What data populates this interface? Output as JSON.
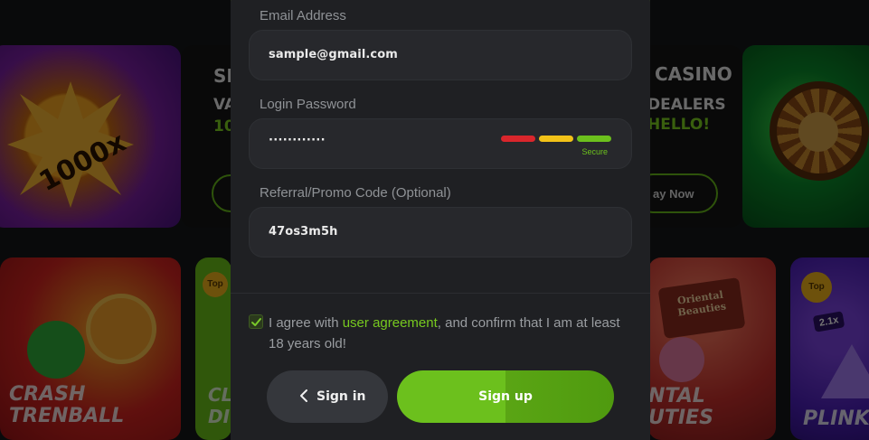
{
  "background": {
    "burst_card": {
      "label": "1000x"
    },
    "promo_left": {
      "line1": "SL",
      "line2": "VA",
      "line3": "10"
    },
    "promo_right": {
      "title": "CASINO",
      "line2": "DEALERS",
      "line3": "HELLO!",
      "button": "ay Now"
    },
    "crash_card": {
      "line1": "CRASH",
      "line2": "TRENBALL"
    },
    "green_card": {
      "badge": "Top",
      "line1": "CL",
      "line2": "DI"
    },
    "oriental_card": {
      "badge_line1": "Oriental",
      "badge_line2": "Beauties",
      "line1": "NTAL",
      "line2": "UTIES"
    },
    "plinko_card": {
      "badge": "Top",
      "multiplier": "2.1x",
      "title": "PLINKO"
    }
  },
  "form": {
    "email": {
      "label": "Email Address",
      "value": "sample@gmail.com"
    },
    "password": {
      "label": "Login Password",
      "value": "············",
      "strength_label": "Secure",
      "strength_colors": [
        "#d9262c",
        "#f2c218",
        "#6cc01d"
      ]
    },
    "referral": {
      "label": "Referral/Promo Code (Optional)",
      "value": "47os3m5h"
    },
    "agreement": {
      "prefix": "I agree with ",
      "link": "user agreement",
      "suffix": ", and confirm that I am at least 18 years old!",
      "checked": true
    },
    "signin_label": "Sign in",
    "signup_label": "Sign up"
  },
  "colors": {
    "accent": "#6cc01d",
    "modal_bg": "#1f2023",
    "field_bg": "#27282c"
  }
}
